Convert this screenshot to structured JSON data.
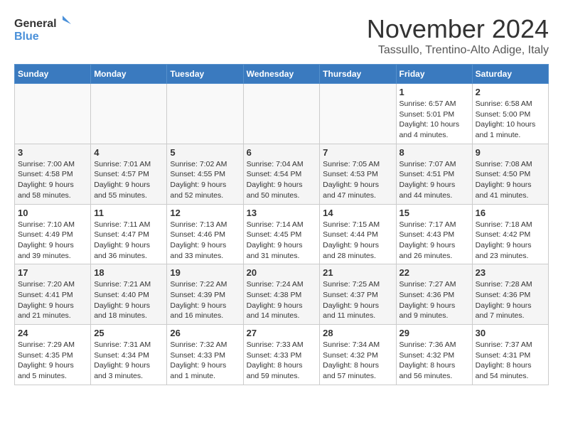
{
  "logo": {
    "line1": "General",
    "line2": "Blue"
  },
  "title": "November 2024",
  "subtitle": "Tassullo, Trentino-Alto Adige, Italy",
  "days_of_week": [
    "Sunday",
    "Monday",
    "Tuesday",
    "Wednesday",
    "Thursday",
    "Friday",
    "Saturday"
  ],
  "weeks": [
    [
      {
        "day": "",
        "content": ""
      },
      {
        "day": "",
        "content": ""
      },
      {
        "day": "",
        "content": ""
      },
      {
        "day": "",
        "content": ""
      },
      {
        "day": "",
        "content": ""
      },
      {
        "day": "1",
        "content": "Sunrise: 6:57 AM\nSunset: 5:01 PM\nDaylight: 10 hours and 4 minutes."
      },
      {
        "day": "2",
        "content": "Sunrise: 6:58 AM\nSunset: 5:00 PM\nDaylight: 10 hours and 1 minute."
      }
    ],
    [
      {
        "day": "3",
        "content": "Sunrise: 7:00 AM\nSunset: 4:58 PM\nDaylight: 9 hours and 58 minutes."
      },
      {
        "day": "4",
        "content": "Sunrise: 7:01 AM\nSunset: 4:57 PM\nDaylight: 9 hours and 55 minutes."
      },
      {
        "day": "5",
        "content": "Sunrise: 7:02 AM\nSunset: 4:55 PM\nDaylight: 9 hours and 52 minutes."
      },
      {
        "day": "6",
        "content": "Sunrise: 7:04 AM\nSunset: 4:54 PM\nDaylight: 9 hours and 50 minutes."
      },
      {
        "day": "7",
        "content": "Sunrise: 7:05 AM\nSunset: 4:53 PM\nDaylight: 9 hours and 47 minutes."
      },
      {
        "day": "8",
        "content": "Sunrise: 7:07 AM\nSunset: 4:51 PM\nDaylight: 9 hours and 44 minutes."
      },
      {
        "day": "9",
        "content": "Sunrise: 7:08 AM\nSunset: 4:50 PM\nDaylight: 9 hours and 41 minutes."
      }
    ],
    [
      {
        "day": "10",
        "content": "Sunrise: 7:10 AM\nSunset: 4:49 PM\nDaylight: 9 hours and 39 minutes."
      },
      {
        "day": "11",
        "content": "Sunrise: 7:11 AM\nSunset: 4:47 PM\nDaylight: 9 hours and 36 minutes."
      },
      {
        "day": "12",
        "content": "Sunrise: 7:13 AM\nSunset: 4:46 PM\nDaylight: 9 hours and 33 minutes."
      },
      {
        "day": "13",
        "content": "Sunrise: 7:14 AM\nSunset: 4:45 PM\nDaylight: 9 hours and 31 minutes."
      },
      {
        "day": "14",
        "content": "Sunrise: 7:15 AM\nSunset: 4:44 PM\nDaylight: 9 hours and 28 minutes."
      },
      {
        "day": "15",
        "content": "Sunrise: 7:17 AM\nSunset: 4:43 PM\nDaylight: 9 hours and 26 minutes."
      },
      {
        "day": "16",
        "content": "Sunrise: 7:18 AM\nSunset: 4:42 PM\nDaylight: 9 hours and 23 minutes."
      }
    ],
    [
      {
        "day": "17",
        "content": "Sunrise: 7:20 AM\nSunset: 4:41 PM\nDaylight: 9 hours and 21 minutes."
      },
      {
        "day": "18",
        "content": "Sunrise: 7:21 AM\nSunset: 4:40 PM\nDaylight: 9 hours and 18 minutes."
      },
      {
        "day": "19",
        "content": "Sunrise: 7:22 AM\nSunset: 4:39 PM\nDaylight: 9 hours and 16 minutes."
      },
      {
        "day": "20",
        "content": "Sunrise: 7:24 AM\nSunset: 4:38 PM\nDaylight: 9 hours and 14 minutes."
      },
      {
        "day": "21",
        "content": "Sunrise: 7:25 AM\nSunset: 4:37 PM\nDaylight: 9 hours and 11 minutes."
      },
      {
        "day": "22",
        "content": "Sunrise: 7:27 AM\nSunset: 4:36 PM\nDaylight: 9 hours and 9 minutes."
      },
      {
        "day": "23",
        "content": "Sunrise: 7:28 AM\nSunset: 4:36 PM\nDaylight: 9 hours and 7 minutes."
      }
    ],
    [
      {
        "day": "24",
        "content": "Sunrise: 7:29 AM\nSunset: 4:35 PM\nDaylight: 9 hours and 5 minutes."
      },
      {
        "day": "25",
        "content": "Sunrise: 7:31 AM\nSunset: 4:34 PM\nDaylight: 9 hours and 3 minutes."
      },
      {
        "day": "26",
        "content": "Sunrise: 7:32 AM\nSunset: 4:33 PM\nDaylight: 9 hours and 1 minute."
      },
      {
        "day": "27",
        "content": "Sunrise: 7:33 AM\nSunset: 4:33 PM\nDaylight: 8 hours and 59 minutes."
      },
      {
        "day": "28",
        "content": "Sunrise: 7:34 AM\nSunset: 4:32 PM\nDaylight: 8 hours and 57 minutes."
      },
      {
        "day": "29",
        "content": "Sunrise: 7:36 AM\nSunset: 4:32 PM\nDaylight: 8 hours and 56 minutes."
      },
      {
        "day": "30",
        "content": "Sunrise: 7:37 AM\nSunset: 4:31 PM\nDaylight: 8 hours and 54 minutes."
      }
    ]
  ]
}
